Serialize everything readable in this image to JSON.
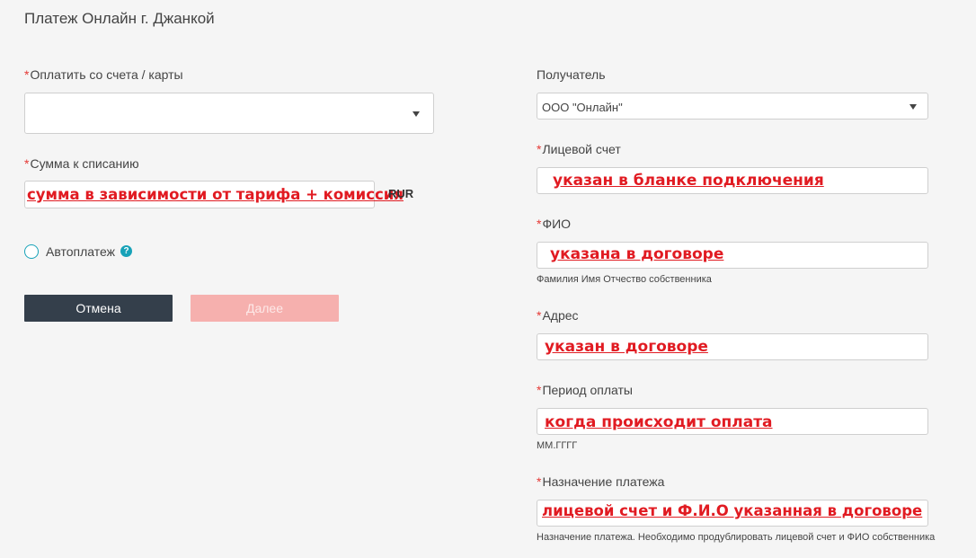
{
  "title": "Платеж Онлайн г. Джанкой",
  "left": {
    "pay_from": {
      "required": "*",
      "label": "Оплатить со счета / карты",
      "value": ""
    },
    "amount": {
      "required": "*",
      "label": "Сумма к списанию",
      "annotation": "сумма в зависимости от тарифа + комиссия",
      "currency": "RUR"
    },
    "autopay": {
      "label": "Автоплатеж",
      "help": "?"
    },
    "buttons": {
      "cancel": "Отмена",
      "next": "Далее"
    }
  },
  "right": {
    "recipient": {
      "label": "Получатель",
      "value": "ООО \"Онлайн\""
    },
    "account": {
      "required": "*",
      "label": "Лицевой счет",
      "annotation": "указан в бланке подключения"
    },
    "fio": {
      "required": "*",
      "label": "ФИО",
      "annotation": "указана в договоре",
      "hint": "Фамилия Имя Отчество собственника"
    },
    "address": {
      "required": "*",
      "label": "Адрес",
      "annotation": "указан в договоре"
    },
    "period": {
      "required": "*",
      "label": "Период оплаты",
      "annotation": "когда происходит оплата",
      "hint": "ММ.ГГГГ"
    },
    "purpose": {
      "required": "*",
      "label": "Назначение платежа",
      "annotation": "лицевой счет и Ф.И.О указанная в договоре",
      "hint": "Назначение платежа. Необходимо продублировать лицевой счет и ФИО собственника"
    }
  },
  "colors": {
    "annotation": "#e11b22",
    "required": "#e53935",
    "accent": "#17a2b8",
    "cancel_bg": "#343f4b",
    "next_bg": "#f6b0ae"
  }
}
